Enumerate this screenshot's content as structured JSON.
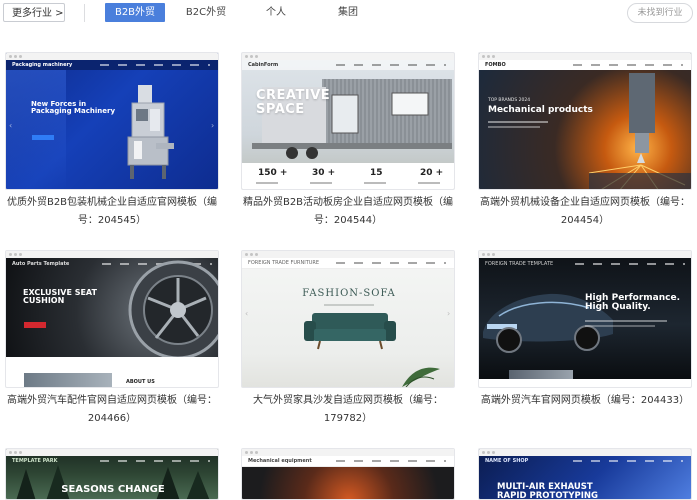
{
  "filters": {
    "more_label": "更多行业 >",
    "tabs": [
      {
        "label": "B2B外贸",
        "active": true
      },
      {
        "label": "B2C外贸",
        "active": false
      },
      {
        "label": "个人",
        "active": false
      },
      {
        "label": "集团",
        "active": false
      }
    ],
    "not_found_label": "未找到行业"
  },
  "cards": [
    {
      "caption": "优质外贸B2B包装机械企业自适应官网模板（编号：204545）",
      "site_logo": "Packaging machinery",
      "hero": "New Forces in Packaging Machinery"
    },
    {
      "caption": "精品外贸B2B活动板房企业自适应网页模板（编号：204544）",
      "site_logo": "CabinForm",
      "hero": "CREATIVE SPACE",
      "stats": [
        {
          "value": "150 +"
        },
        {
          "value": "30 +"
        },
        {
          "value": "15"
        },
        {
          "value": "20 +"
        }
      ]
    },
    {
      "caption": "高端外贸机械设备企业自适应网页模板（编号：204454）",
      "site_logo": "FOMBO",
      "hero_small": "TOP BRANDS 2024",
      "hero": "Mechanical products"
    },
    {
      "caption": "高端外贸汽车配件官网自适应网页模板（编号：204466）",
      "site_logo": "Auto Parts Template",
      "hero": "EXCLUSIVE SEAT CUSHION",
      "footer_text": "ABOUT US"
    },
    {
      "caption": "大气外贸家具沙发自适应网页模板（编号：179782）",
      "site_logo": "FOREIGN TRADE FURNITURE",
      "hero": "FASHION-SOFA"
    },
    {
      "caption": "高端外贸汽车官网网页模板（编号：204433）",
      "site_logo": "FOREIGN TRADE TEMPLATE",
      "hero": "High Performance. High Quality."
    },
    {
      "caption": "",
      "site_logo": "TEMPLATE PARK",
      "hero": "SEASONS CHANGE"
    },
    {
      "caption": "",
      "site_logo": "Mechanical equipment",
      "hero": ""
    },
    {
      "caption": "",
      "site_logo": "NAME OF SHOP",
      "hero": "MULTI-AIR EXHAUST RAPID PROTOTYPING"
    }
  ]
}
